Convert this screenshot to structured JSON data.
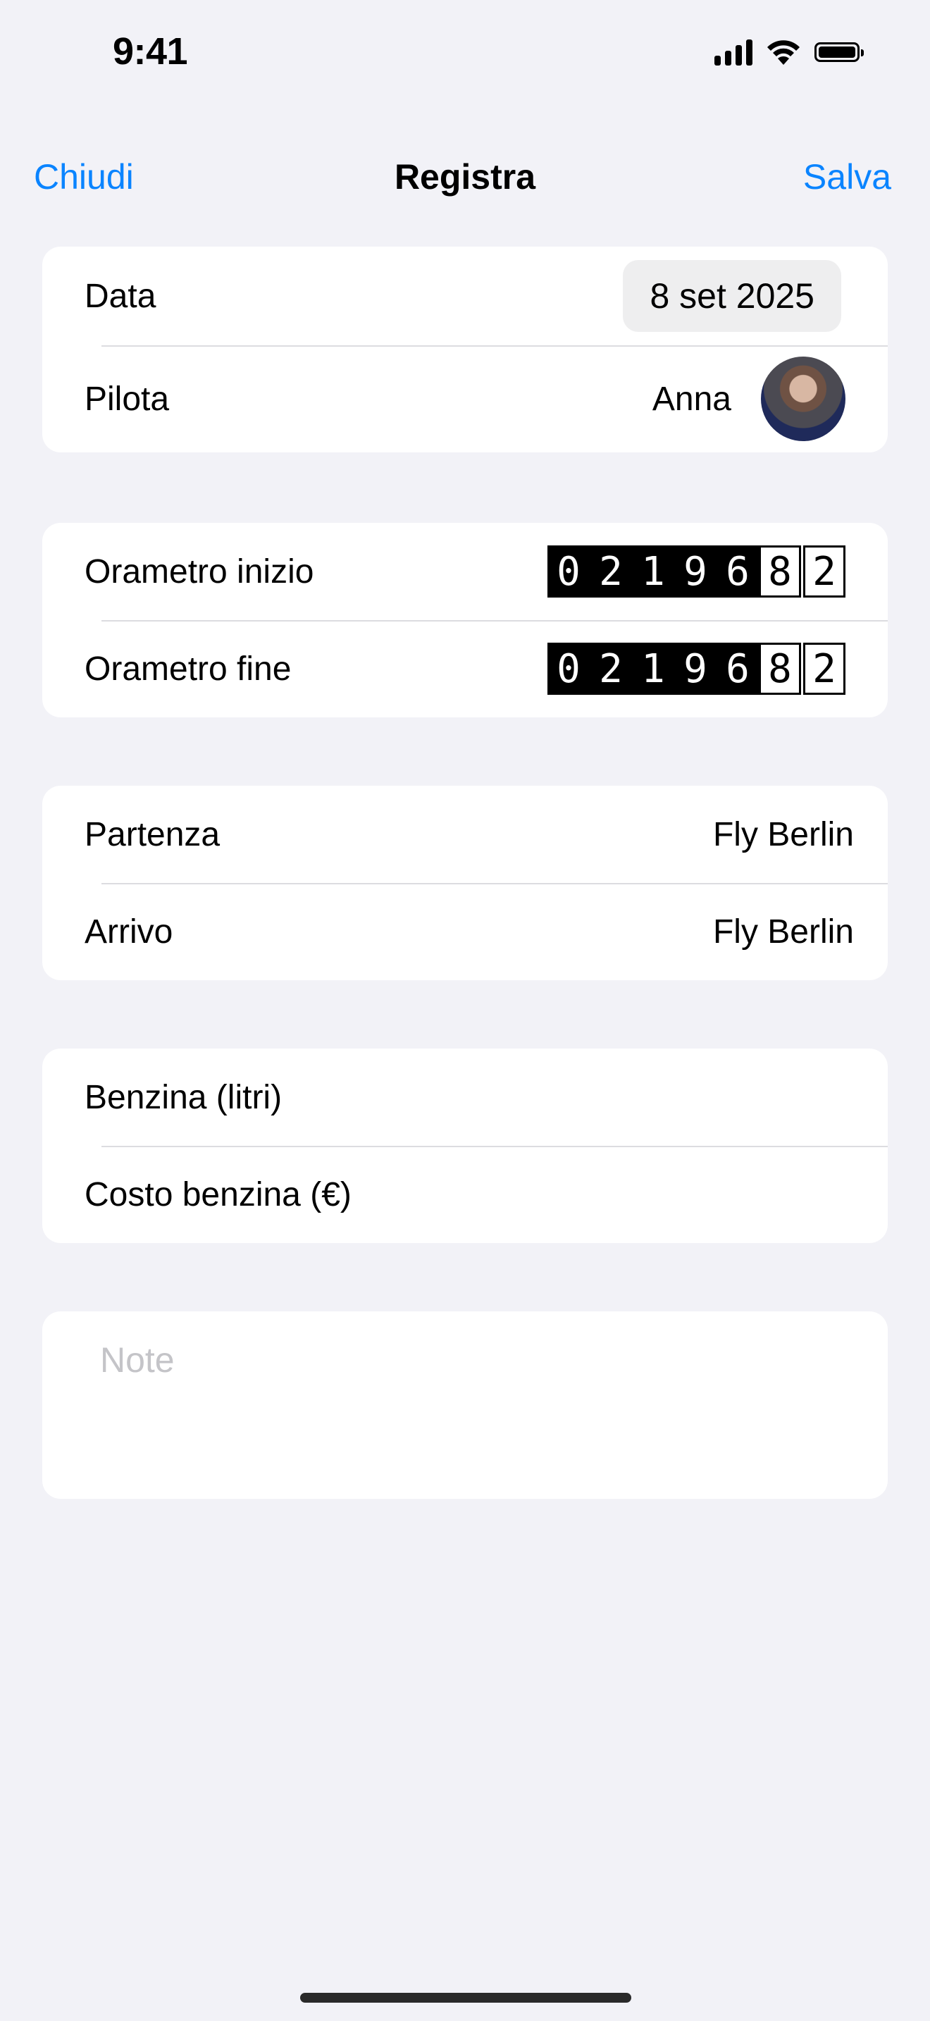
{
  "status_bar": {
    "time": "9:41"
  },
  "nav": {
    "left": "Chiudi",
    "title": "Registra",
    "right": "Salva"
  },
  "section1": {
    "date_label": "Data",
    "date_value": "8 set 2025",
    "pilot_label": "Pilota",
    "pilot_value": "Anna"
  },
  "section2": {
    "start_label": "Orametro inizio",
    "start_digits": [
      "0",
      "2",
      "1",
      "9",
      "6",
      "8",
      "2"
    ],
    "end_label": "Orametro fine",
    "end_digits": [
      "0",
      "2",
      "1",
      "9",
      "6",
      "8",
      "2"
    ]
  },
  "section3": {
    "departure_label": "Partenza",
    "departure_value": "Fly Berlin",
    "arrival_label": "Arrivo",
    "arrival_value": "Fly Berlin"
  },
  "section4": {
    "fuel_label": "Benzina (litri)",
    "fuel_cost_label": "Costo benzina (€)"
  },
  "notes": {
    "placeholder": "Note"
  },
  "colors": {
    "accent": "#0a84ff",
    "background": "#f2f2f7"
  }
}
